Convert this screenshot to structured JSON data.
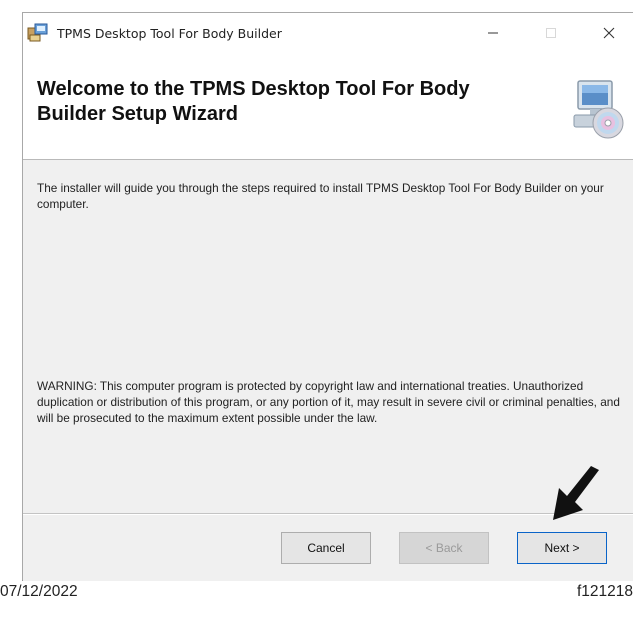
{
  "window": {
    "title": "TPMS Desktop Tool For Body Builder",
    "controls": {
      "minimize": "—",
      "close": "×"
    }
  },
  "header": {
    "title": "Welcome to the TPMS Desktop Tool For Body Builder Setup Wizard",
    "icon": "computer-cd-icon"
  },
  "content": {
    "intro": "The installer will guide you through the steps required to install TPMS Desktop Tool For Body Builder on your computer.",
    "warning": "WARNING: This computer program is protected by copyright law and international treaties. Unauthorized duplication or distribution of this program, or any portion of it, may result in severe civil or criminal penalties, and will be prosecuted to the maximum extent possible under the law."
  },
  "buttons": {
    "cancel": "Cancel",
    "back": "< Back",
    "next": "Next >"
  },
  "annotation": {
    "arrow": "pointer-arrow-icon"
  },
  "footer": {
    "date": "07/12/2022",
    "code": "f121218"
  },
  "colors": {
    "content_bg": "#f0f0f0",
    "focus_border": "#0a64c8",
    "disabled_text": "#9a9a9a"
  }
}
